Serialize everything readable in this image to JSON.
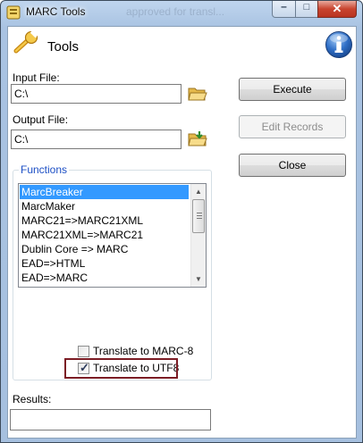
{
  "window": {
    "title": "MARC Tools",
    "background_title_fragment": "approved for transl...",
    "controls": {
      "minimize": "–",
      "maximize": "□",
      "close": "✕"
    }
  },
  "header": {
    "title": "Tools",
    "icons": {
      "tools": "wrench-icon",
      "info": "info-icon"
    }
  },
  "input_file": {
    "label": "Input File:",
    "value": "C:\\"
  },
  "output_file": {
    "label": "Output File:",
    "value": "C:\\"
  },
  "buttons": {
    "execute": "Execute",
    "edit_records": "Edit Records",
    "close": "Close"
  },
  "functions": {
    "legend": "Functions",
    "items": [
      "MarcBreaker",
      "MarcMaker",
      "MARC21=>MARC21XML",
      "MARC21XML=>MARC21",
      "Dublin Core => MARC",
      "EAD=>HTML",
      "EAD=>MARC"
    ],
    "selected_index": 0
  },
  "options": {
    "translate_marc8": {
      "label": "Translate to MARC-8",
      "checked": false
    },
    "translate_utf8": {
      "label": "Translate to UTF8",
      "checked": true
    }
  },
  "results": {
    "label": "Results:",
    "value": ""
  },
  "colors": {
    "accent_legend": "#1c4fc5",
    "selection": "#3399ff",
    "highlight_border": "#7b1c24"
  }
}
